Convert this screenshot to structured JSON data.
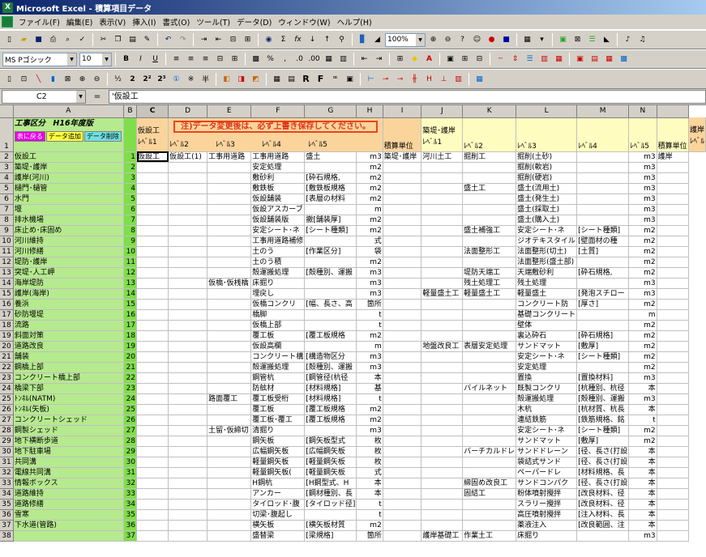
{
  "window": {
    "title": "Microsoft Excel - 積算項目データ"
  },
  "menu": [
    "ファイル(F)",
    "編集(E)",
    "表示(V)",
    "挿入(I)",
    "書式(O)",
    "ツール(T)",
    "データ(D)",
    "ウィンドウ(W)",
    "ヘルプ(H)"
  ],
  "toolbar1": {
    "zoom": "100%"
  },
  "toolbar2": {
    "font_name": "MS Pゴシック",
    "font_size": "10"
  },
  "toolbar3": {},
  "formula_bar": {
    "cell_ref": "C2",
    "content": "'仮設工"
  },
  "columns": [
    "A",
    "B",
    "C",
    "D",
    "E",
    "F",
    "G",
    "H",
    "I",
    "J",
    "K",
    "L",
    "M",
    "N",
    ""
  ],
  "header_block": {
    "a_title": "工事区分　H16年度版",
    "btn_back": "表に戻る",
    "btn_add": "データ追加",
    "btn_del": "データ削除",
    "c_top": "仮設工",
    "notice": "注)データ変更後は、必ず上書き保存してください。",
    "i_top": "築堤･護岸",
    "o_top": "護岸",
    "level_labels": [
      "ﾚﾍﾞﾙ1",
      "ﾚﾍﾞﾙ2",
      "ﾚﾍﾞﾙ3",
      "ﾚﾍﾞﾙ4",
      "ﾚﾍﾞﾙ5",
      "積算単位",
      "ﾚﾍﾞﾙ1",
      "ﾚﾍﾞﾙ2",
      "ﾚﾍﾞﾙ3",
      "ﾚﾍﾞﾙ4",
      "ﾚﾍﾞﾙ5",
      "積算単位",
      "ﾚﾍﾞﾙ"
    ]
  },
  "rows": [
    {
      "n": "2",
      "a": "仮設工",
      "b": "1",
      "c": "仮設工",
      "d": "仮設工(1)",
      "e": "工事用道路",
      "f": "工事用道路",
      "g": "盛土",
      "h": "m3",
      "i": "築堤･護岸",
      "j": "河川土工",
      "k": "掘削工",
      "l": "掘削(土砂)",
      "m": "",
      "o": "m3",
      "p": "護岸"
    },
    {
      "n": "3",
      "a": "築堤･護岸",
      "b": "2",
      "c": "",
      "d": "",
      "e": "",
      "f": "安定処理",
      "g": "",
      "h": "m2",
      "i": "",
      "j": "",
      "k": "",
      "l": "掘削(軟岩)",
      "m": "",
      "o": "m3",
      "p": ""
    },
    {
      "n": "4",
      "a": "護岸(河川)",
      "b": "3",
      "c": "",
      "d": "",
      "e": "",
      "f": "敷砂利",
      "g": "[砕石規格,",
      "h": "m2",
      "i": "",
      "j": "",
      "k": "",
      "l": "掘削(硬岩)",
      "m": "",
      "o": "m3",
      "p": ""
    },
    {
      "n": "5",
      "a": "樋門･樋管",
      "b": "4",
      "c": "",
      "d": "",
      "e": "",
      "f": "敷鉄板",
      "g": "[敷鉄板規格",
      "h": "m2",
      "i": "",
      "j": "",
      "k": "盛土工",
      "l": "盛土(流用土)",
      "m": "",
      "o": "m3",
      "p": ""
    },
    {
      "n": "6",
      "a": "水門",
      "b": "5",
      "c": "",
      "d": "",
      "e": "",
      "f": "仮設舗装",
      "g": "[表層の材料",
      "h": "m2",
      "i": "",
      "j": "",
      "k": "",
      "l": "盛土(発生土)",
      "m": "",
      "o": "m3",
      "p": ""
    },
    {
      "n": "7",
      "a": "堰",
      "b": "6",
      "c": "",
      "d": "",
      "e": "",
      "f": "仮設アスカーブ",
      "g": "",
      "h": "m",
      "i": "",
      "j": "",
      "k": "",
      "l": "盛土(採取土)",
      "m": "",
      "o": "m3",
      "p": ""
    },
    {
      "n": "8",
      "a": "排水機場",
      "b": "7",
      "c": "",
      "d": "",
      "e": "",
      "f": "仮設舗装版",
      "g": "撤[舗装厚]",
      "h": "m2",
      "i": "",
      "j": "",
      "k": "",
      "l": "盛土(購入土)",
      "m": "",
      "o": "m3",
      "p": ""
    },
    {
      "n": "9",
      "a": "床止め･床固め",
      "b": "8",
      "c": "",
      "d": "",
      "e": "",
      "f": "安定シート･ネ",
      "g": "[シート種類]",
      "h": "m2",
      "i": "",
      "j": "",
      "k": "盛土補強工",
      "l": "安定シート･ネ",
      "m": "[シート種類]",
      "o": "m2",
      "p": ""
    },
    {
      "n": "10",
      "a": "河川維持",
      "b": "9",
      "c": "",
      "d": "",
      "e": "",
      "f": "工事用道路補修",
      "g": "",
      "h": "式",
      "i": "",
      "j": "",
      "k": "",
      "l": "ジオテキスタイル",
      "m": "[壁面材の種",
      "o": "m2",
      "p": ""
    },
    {
      "n": "11",
      "a": "河川修繕",
      "b": "10",
      "c": "",
      "d": "",
      "e": "",
      "f": "土のう",
      "g": "[作業区分]",
      "h": "袋",
      "i": "",
      "j": "",
      "k": "法面整形工",
      "l": "法面整形(切土)",
      "m": "[土質]",
      "o": "m2",
      "p": ""
    },
    {
      "n": "12",
      "a": "堤防･護岸",
      "b": "11",
      "c": "",
      "d": "",
      "e": "",
      "f": "土のう積",
      "g": "",
      "h": "m2",
      "i": "",
      "j": "",
      "k": "",
      "l": "法面整形(盛土部)",
      "m": "",
      "o": "m2",
      "p": ""
    },
    {
      "n": "13",
      "a": "突堤･人工岬",
      "b": "12",
      "c": "",
      "d": "",
      "e": "",
      "f": "殻運搬処理",
      "g": "[殻種別、運搬",
      "h": "m3",
      "i": "",
      "j": "",
      "k": "堤防天端工",
      "l": "天端敷砂利",
      "m": "[砕石規格,",
      "o": "m2",
      "p": ""
    },
    {
      "n": "14",
      "a": "海岸堤防",
      "b": "13",
      "c": "",
      "d": "",
      "e": "仮橋･仮桟橋",
      "f": "床掘り",
      "g": "",
      "h": "m3",
      "i": "",
      "j": "",
      "k": "残土処理工",
      "l": "残土処理",
      "m": "",
      "o": "m3",
      "p": ""
    },
    {
      "n": "15",
      "a": "護岸(海岸)",
      "b": "14",
      "c": "",
      "d": "",
      "e": "",
      "f": "埋戻し",
      "g": "",
      "h": "m3",
      "i": "",
      "j": "軽量盛土工",
      "k": "軽量盛土工",
      "l": "軽量盛土",
      "m": "[発泡スチロー",
      "o": "m3",
      "p": ""
    },
    {
      "n": "16",
      "a": "養浜",
      "b": "15",
      "c": "",
      "d": "",
      "e": "",
      "f": "仮橋コンクリ",
      "g": "[幅、長さ、高",
      "h": "箇所",
      "i": "",
      "j": "",
      "k": "",
      "l": "コンクリート防",
      "m": "[厚さ]",
      "o": "m2",
      "p": ""
    },
    {
      "n": "17",
      "a": "砂防堰堤",
      "b": "16",
      "c": "",
      "d": "",
      "e": "",
      "f": "橋脚",
      "g": "",
      "h": "t",
      "i": "",
      "j": "",
      "k": "",
      "l": "基礎コンクリート",
      "m": "",
      "o": "m",
      "p": ""
    },
    {
      "n": "18",
      "a": "流路",
      "b": "17",
      "c": "",
      "d": "",
      "e": "",
      "f": "仮橋上部",
      "g": "",
      "h": "t",
      "i": "",
      "j": "",
      "k": "",
      "l": "壁体",
      "m": "",
      "o": "m2",
      "p": ""
    },
    {
      "n": "19",
      "a": "斜面対策",
      "b": "18",
      "c": "",
      "d": "",
      "e": "",
      "f": "覆工板",
      "g": "[覆工板規格",
      "h": "m2",
      "i": "",
      "j": "",
      "k": "",
      "l": "裏込砕石",
      "m": "[砕石規格]",
      "o": "m2",
      "p": ""
    },
    {
      "n": "20",
      "a": "道路改良",
      "b": "19",
      "c": "",
      "d": "",
      "e": "",
      "f": "仮設高欄",
      "g": "",
      "h": "m",
      "i": "",
      "j": "地盤改良工",
      "k": "表層安定処理",
      "l": "サンドマット",
      "m": "[敷厚]",
      "o": "m2",
      "p": ""
    },
    {
      "n": "21",
      "a": "舗装",
      "b": "20",
      "c": "",
      "d": "",
      "e": "",
      "f": "コンクリート構",
      "g": "[構造物区分",
      "h": "m3",
      "i": "",
      "j": "",
      "k": "",
      "l": "安定シート･ネ",
      "m": "[シート種類]",
      "o": "m2",
      "p": ""
    },
    {
      "n": "22",
      "a": "鋼橋上部",
      "b": "21",
      "c": "",
      "d": "",
      "e": "",
      "f": "殻運搬処理",
      "g": "[殻種別、運搬",
      "h": "m3",
      "i": "",
      "j": "",
      "k": "",
      "l": "安定処理",
      "m": "",
      "o": "m2",
      "p": ""
    },
    {
      "n": "23",
      "a": "コンクリート橋上部",
      "b": "22",
      "c": "",
      "d": "",
      "e": "",
      "f": "鋼管杭",
      "g": "[鋼管径(杭径",
      "h": "本",
      "i": "",
      "j": "",
      "k": "",
      "l": "置換",
      "m": "[置換材料]",
      "o": "m3",
      "p": ""
    },
    {
      "n": "24",
      "a": "橋梁下部",
      "b": "23",
      "c": "",
      "d": "",
      "e": "",
      "f": "防舷材",
      "g": "[材料規格]",
      "h": "基",
      "i": "",
      "j": "",
      "k": "バイルネット",
      "l": "既製コンクリ",
      "m": "[杭種別、杭径",
      "o": "本",
      "p": ""
    },
    {
      "n": "25",
      "a": "ﾄﾝﾈﾙ(NATM)",
      "b": "24",
      "c": "",
      "d": "",
      "e": "路面覆工",
      "f": "覆工板受桁",
      "g": "[材料規格]",
      "h": "t",
      "i": "",
      "j": "",
      "k": "",
      "l": "殻運搬処理",
      "m": "[殻種別、運搬",
      "o": "m3",
      "p": ""
    },
    {
      "n": "26",
      "a": "ﾄﾝﾈﾙ(矢板)",
      "b": "25",
      "c": "",
      "d": "",
      "e": "",
      "f": "覆工板",
      "g": "[覆工板規格",
      "h": "m2",
      "i": "",
      "j": "",
      "k": "",
      "l": "木杭",
      "m": "[杭材質、杭長",
      "o": "本",
      "p": ""
    },
    {
      "n": "27",
      "a": "コンクリートシェッド",
      "b": "26",
      "c": "",
      "d": "",
      "e": "",
      "f": "覆工板･覆工",
      "g": "[覆工板規格",
      "h": "m2",
      "i": "",
      "j": "",
      "k": "",
      "l": "連結鉄筋",
      "m": "[鉄筋規格、銘",
      "o": "t",
      "p": ""
    },
    {
      "n": "28",
      "a": "鋼製シェッド",
      "b": "27",
      "c": "",
      "d": "",
      "e": "土留･仮締切",
      "f": "清掘り",
      "g": "",
      "h": "m3",
      "i": "",
      "j": "",
      "k": "",
      "l": "安定シート･ネ",
      "m": "[シート種類]",
      "o": "m2",
      "p": ""
    },
    {
      "n": "29",
      "a": "地下横断歩道",
      "b": "28",
      "c": "",
      "d": "",
      "e": "",
      "f": "鋼矢板",
      "g": "[鋼矢板型式",
      "h": "枚",
      "i": "",
      "j": "",
      "k": "",
      "l": "サンドマット",
      "m": "[敷厚]",
      "o": "m2",
      "p": ""
    },
    {
      "n": "30",
      "a": "地下駐車場",
      "b": "29",
      "c": "",
      "d": "",
      "e": "",
      "f": "広幅鋼矢板",
      "g": "[広幅鋼矢板",
      "h": "枚",
      "i": "",
      "j": "",
      "k": "バーチカルドレ",
      "l": "サンドドレーン",
      "m": "[径、長さ(打設",
      "o": "本",
      "p": ""
    },
    {
      "n": "31",
      "a": "共同溝",
      "b": "30",
      "c": "",
      "d": "",
      "e": "",
      "f": "軽量鋼矢板",
      "g": "[軽量鋼矢板",
      "h": "枚",
      "i": "",
      "j": "",
      "k": "",
      "l": "袋詰式サンド",
      "m": "[径、長さ(打設",
      "o": "本",
      "p": ""
    },
    {
      "n": "32",
      "a": "電線共同溝",
      "b": "31",
      "c": "",
      "d": "",
      "e": "",
      "f": "軽量鋼矢板(",
      "g": "[軽量鋼矢板",
      "h": "式",
      "i": "",
      "j": "",
      "k": "",
      "l": "ペーパードレ",
      "m": "[材料規格、長",
      "o": "本",
      "p": ""
    },
    {
      "n": "33",
      "a": "情報ボックス",
      "b": "32",
      "c": "",
      "d": "",
      "e": "",
      "f": "H鋼杭",
      "g": "[H鋼型式、H",
      "h": "本",
      "i": "",
      "j": "",
      "k": "締固め改良工",
      "l": "サンドコンパク",
      "m": "[径、長さ(打設",
      "o": "本",
      "p": ""
    },
    {
      "n": "34",
      "a": "道路維持",
      "b": "33",
      "c": "",
      "d": "",
      "e": "",
      "f": "アンカー",
      "g": "[鋼材種別、長",
      "h": "本",
      "i": "",
      "j": "",
      "k": "固結工",
      "l": "粉体噴射攪拌",
      "m": "[改良材料、径",
      "o": "本",
      "p": ""
    },
    {
      "n": "35",
      "a": "道路修繕",
      "b": "34",
      "c": "",
      "d": "",
      "e": "",
      "f": "タイロッド･腹",
      "g": "[タイロッド径]",
      "h": "t",
      "i": "",
      "j": "",
      "k": "",
      "l": "スラリー攪拌",
      "m": "[改良材料、径",
      "o": "本",
      "p": ""
    },
    {
      "n": "36",
      "a": "雪寒",
      "b": "35",
      "c": "",
      "d": "",
      "e": "",
      "f": "切梁･腹起し",
      "g": "",
      "h": "t",
      "i": "",
      "j": "",
      "k": "",
      "l": "高圧噴射攪拌",
      "m": "[注入材料、長",
      "o": "本",
      "p": ""
    },
    {
      "n": "37",
      "a": "下水道(管路)",
      "b": "36",
      "c": "",
      "d": "",
      "e": "",
      "f": "横矢板",
      "g": "[横矢板材質",
      "h": "m2",
      "i": "",
      "j": "",
      "k": "",
      "l": "薬液注入",
      "m": "[改良範囲、注",
      "o": "本",
      "p": ""
    },
    {
      "n": "38",
      "a": "",
      "b": "37",
      "c": "",
      "d": "",
      "e": "",
      "f": "盛替梁",
      "g": "[梁規格]",
      "h": "箇所",
      "i": "",
      "j": "護岸基礎工",
      "k": "作業土工",
      "l": "床掘り",
      "m": "",
      "o": "m3",
      "p": ""
    }
  ]
}
